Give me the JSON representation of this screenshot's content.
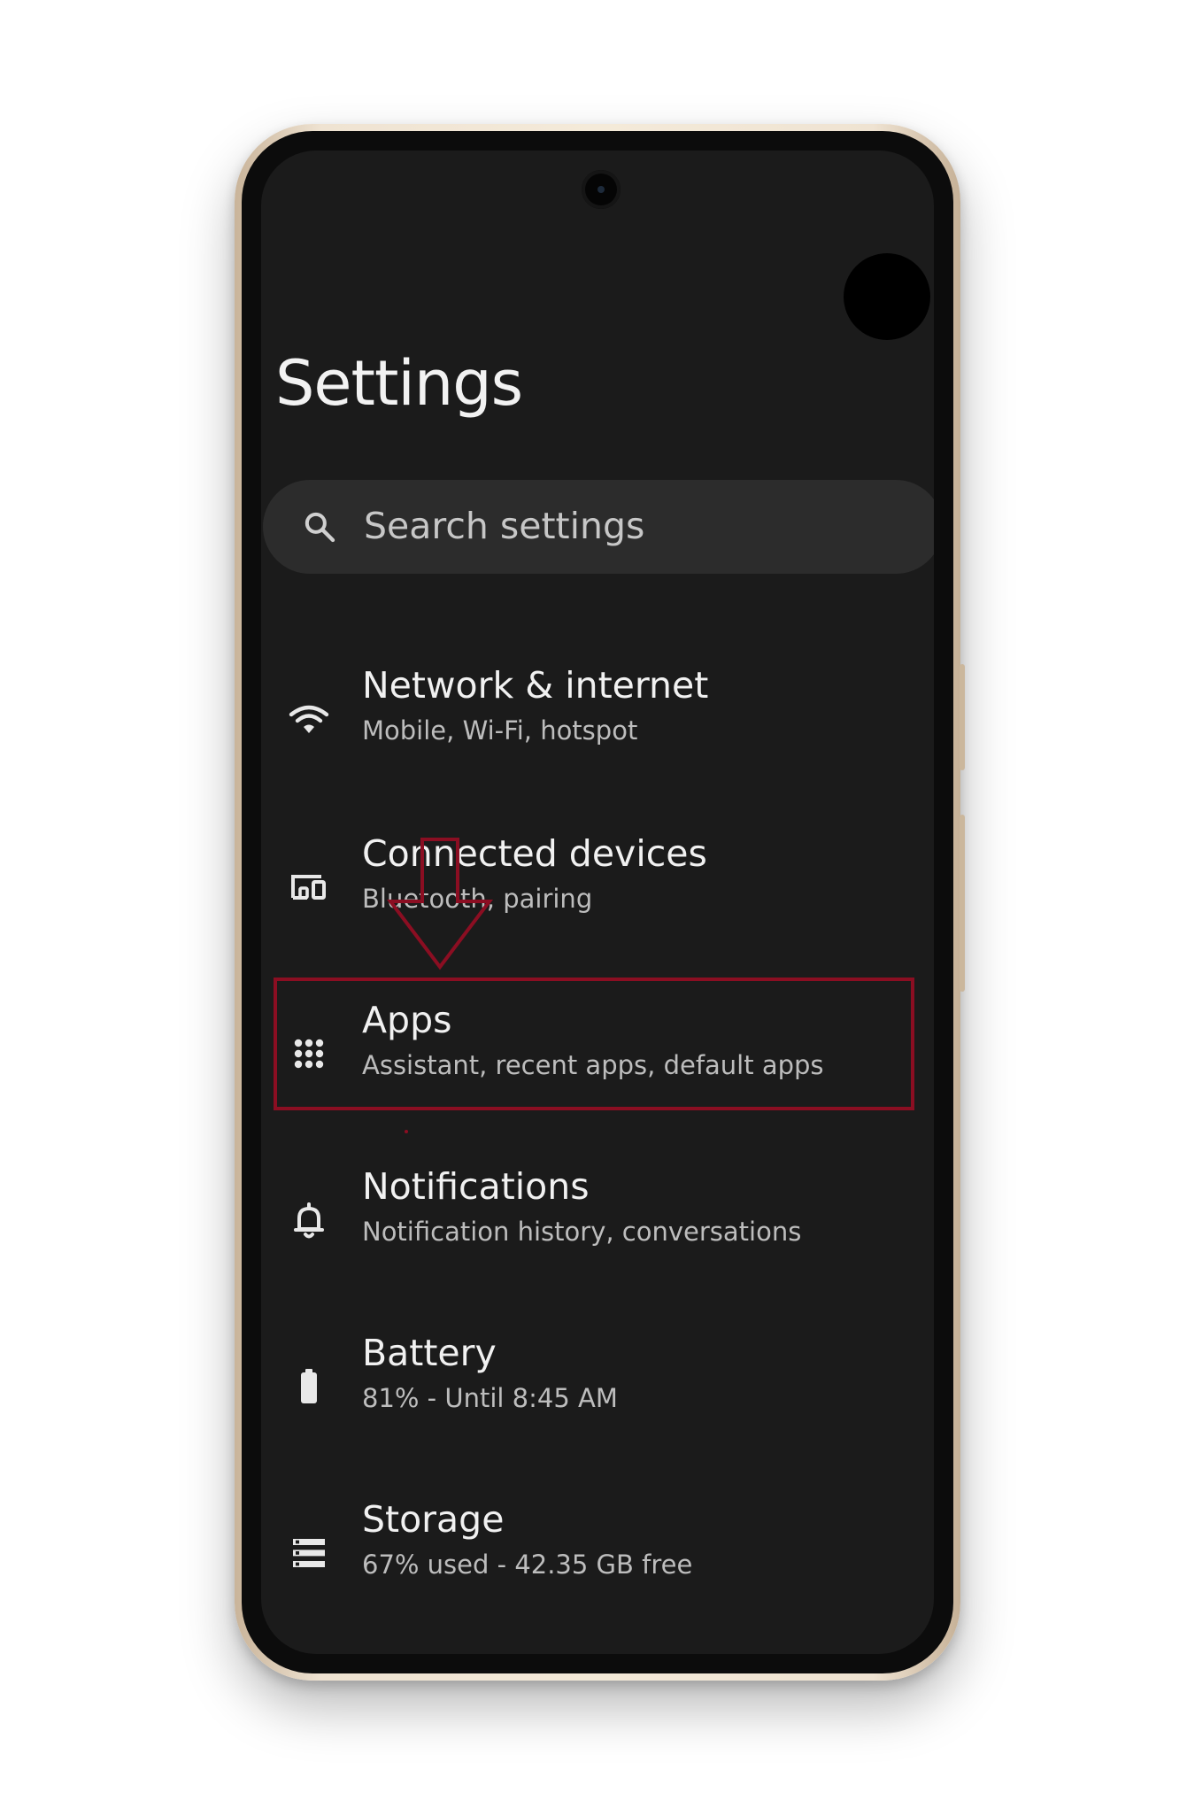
{
  "screen": {
    "title": "Settings"
  },
  "search": {
    "placeholder": "Search settings"
  },
  "items": [
    {
      "title": "Network & internet",
      "subtitle": "Mobile, Wi-Fi, hotspot",
      "icon": "wifi-icon"
    },
    {
      "title": "Connected devices",
      "subtitle": "Bluetooth, pairing",
      "icon": "devices-icon"
    },
    {
      "title": "Apps",
      "subtitle": "Assistant, recent apps, default apps",
      "icon": "apps-grid-icon"
    },
    {
      "title": "Notifications",
      "subtitle": "Notification history, conversations",
      "icon": "bell-icon"
    },
    {
      "title": "Battery",
      "subtitle": "81% - Until 8:45 AM",
      "icon": "battery-icon"
    },
    {
      "title": "Storage",
      "subtitle": "67% used - 42.35 GB free",
      "icon": "storage-icon"
    }
  ],
  "colors": {
    "background": "#1b1b1b",
    "search_bg": "#2c2c2c",
    "highlight": "#8b0e22",
    "text_primary": "#f1f1f1",
    "text_secondary": "#bdbdbd"
  }
}
